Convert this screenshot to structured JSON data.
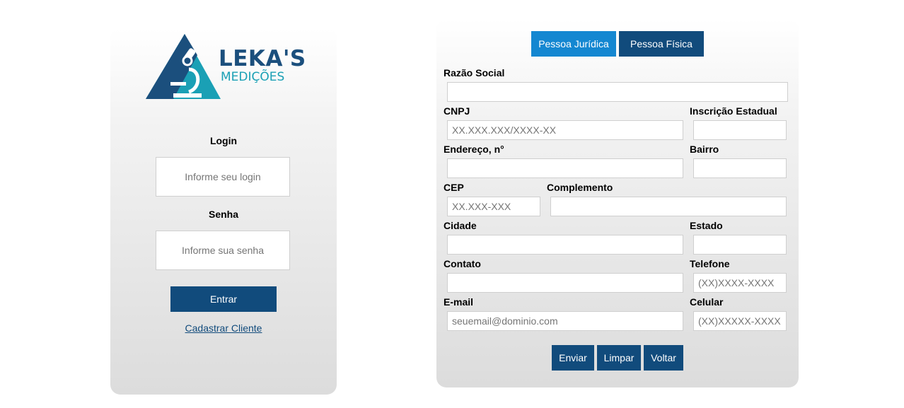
{
  "login": {
    "logo": {
      "title": "LEKA'S",
      "subtitle": "MEDIÇÕES",
      "colors": {
        "dark": "#1b4f7d",
        "light": "#1aa0b5"
      }
    },
    "login_label": "Login",
    "login_placeholder": "Informe seu login",
    "password_label": "Senha",
    "password_placeholder": "Informe sua senha",
    "submit_label": "Entrar",
    "register_link": "Cadastrar Cliente"
  },
  "register": {
    "tabs": [
      {
        "label": "Pessoa Jurídica",
        "color": "#1487d1"
      },
      {
        "label": "Pessoa Física",
        "color": "#114b7c"
      }
    ],
    "fields": {
      "razao_social": {
        "label": "Razão Social",
        "placeholder": ""
      },
      "cnpj": {
        "label": "CNPJ",
        "placeholder": "XX.XXX.XXX/XXXX-XX"
      },
      "inscricao": {
        "label": "Inscrição Estadual",
        "placeholder": ""
      },
      "endereco": {
        "label": "Endereço, n°",
        "placeholder": ""
      },
      "bairro": {
        "label": "Bairro",
        "placeholder": ""
      },
      "cep": {
        "label": "CEP",
        "placeholder": "XX.XXX-XXX"
      },
      "complemento": {
        "label": "Complemento",
        "placeholder": ""
      },
      "cidade": {
        "label": "Cidade",
        "placeholder": ""
      },
      "estado": {
        "label": "Estado",
        "placeholder": ""
      },
      "contato": {
        "label": "Contato",
        "placeholder": ""
      },
      "telefone": {
        "label": "Telefone",
        "placeholder": "(XX)XXXX-XXXX"
      },
      "email": {
        "label": "E-mail",
        "placeholder": "seuemail@dominio.com"
      },
      "celular": {
        "label": "Celular",
        "placeholder": "(XX)XXXXX-XXXX"
      }
    },
    "buttons": {
      "send": "Enviar",
      "clear": "Limpar",
      "back": "Voltar"
    }
  },
  "theme": {
    "primary": "#114b7c",
    "accent": "#1487d1"
  }
}
